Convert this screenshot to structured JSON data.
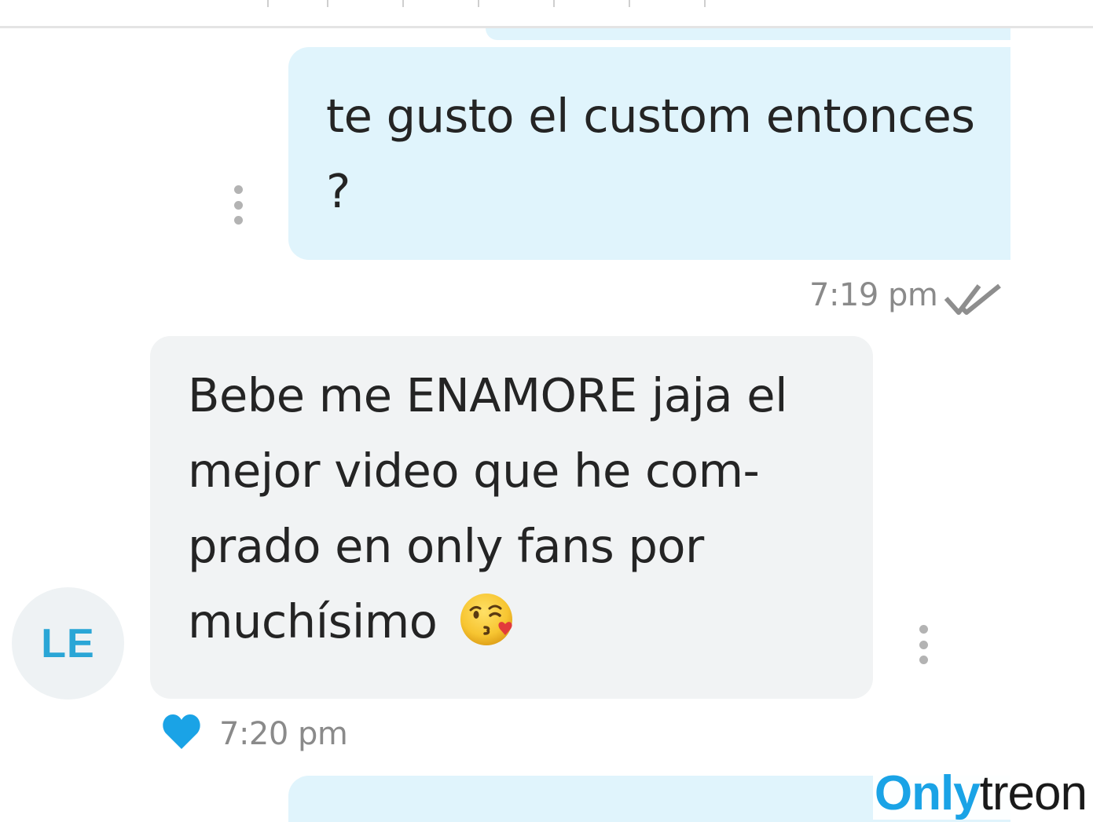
{
  "conversation": {
    "outgoing_message": {
      "text": "te gusto el custom entonces ?",
      "time": "7:19 pm",
      "status_icon": "double-check-icon"
    },
    "incoming_message": {
      "text": "Bebe me ENAMORE jaja el mejor video que he com- prado en only fans por muchísimo",
      "emoji": "kissing-face-with-heart-emoji",
      "time": "7:20 pm",
      "liked": true,
      "like_icon": "heart-icon"
    },
    "sender_avatar": {
      "initials": "LE"
    },
    "menu_icon": "more-vertical-icon"
  },
  "watermark": {
    "part_a": "Only",
    "part_b": "treon"
  },
  "colors": {
    "outgoing_bubble": "#e0f4fc",
    "incoming_bubble": "#f1f3f4",
    "accent_blue": "#1aa3e6",
    "heart": "#1aa3e6",
    "timestamp_grey": "#8a8a8a"
  }
}
